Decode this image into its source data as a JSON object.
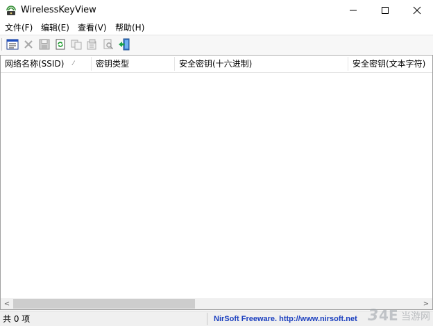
{
  "window": {
    "title": "WirelessKeyView",
    "minimize_glyph": "—",
    "maximize_glyph": "☐",
    "close_glyph": "✕"
  },
  "menu": {
    "items": [
      {
        "label": "文件(F)"
      },
      {
        "label": "编辑(E)"
      },
      {
        "label": "查看(V)"
      },
      {
        "label": "帮助(H)"
      }
    ]
  },
  "toolbar": {
    "buttons": [
      {
        "icon": "properties-icon",
        "enabled": true
      },
      {
        "icon": "delete-icon",
        "enabled": false
      },
      {
        "icon": "save-icon",
        "enabled": false
      },
      {
        "icon": "refresh-icon",
        "enabled": true
      },
      {
        "icon": "copy-icon",
        "enabled": false
      },
      {
        "icon": "copy-key-icon",
        "enabled": false
      },
      {
        "icon": "find-icon",
        "enabled": false
      },
      {
        "icon": "exit-icon",
        "enabled": true
      }
    ]
  },
  "table": {
    "columns": [
      {
        "label": "网络名称(SSID)",
        "sorted": true,
        "sort_glyph": "⁄"
      },
      {
        "label": "密钥类型"
      },
      {
        "label": "安全密钥(十六进制)"
      },
      {
        "label": "安全密钥(文本字符)"
      }
    ],
    "rows": []
  },
  "scrollbar": {
    "left_glyph": "<",
    "right_glyph": ">",
    "thumb_fraction": 0.43
  },
  "status": {
    "count_text": "共 0 项",
    "link_text": "NirSoft Freeware.  http://www.nirsoft.net",
    "link_color": "#1b3fbf"
  },
  "watermark": {
    "text": "当游网"
  },
  "colors": {
    "accent": "#1b3fbf",
    "toolbar_bg": "#f7f7f7",
    "status_bg": "#f0f0f0"
  }
}
